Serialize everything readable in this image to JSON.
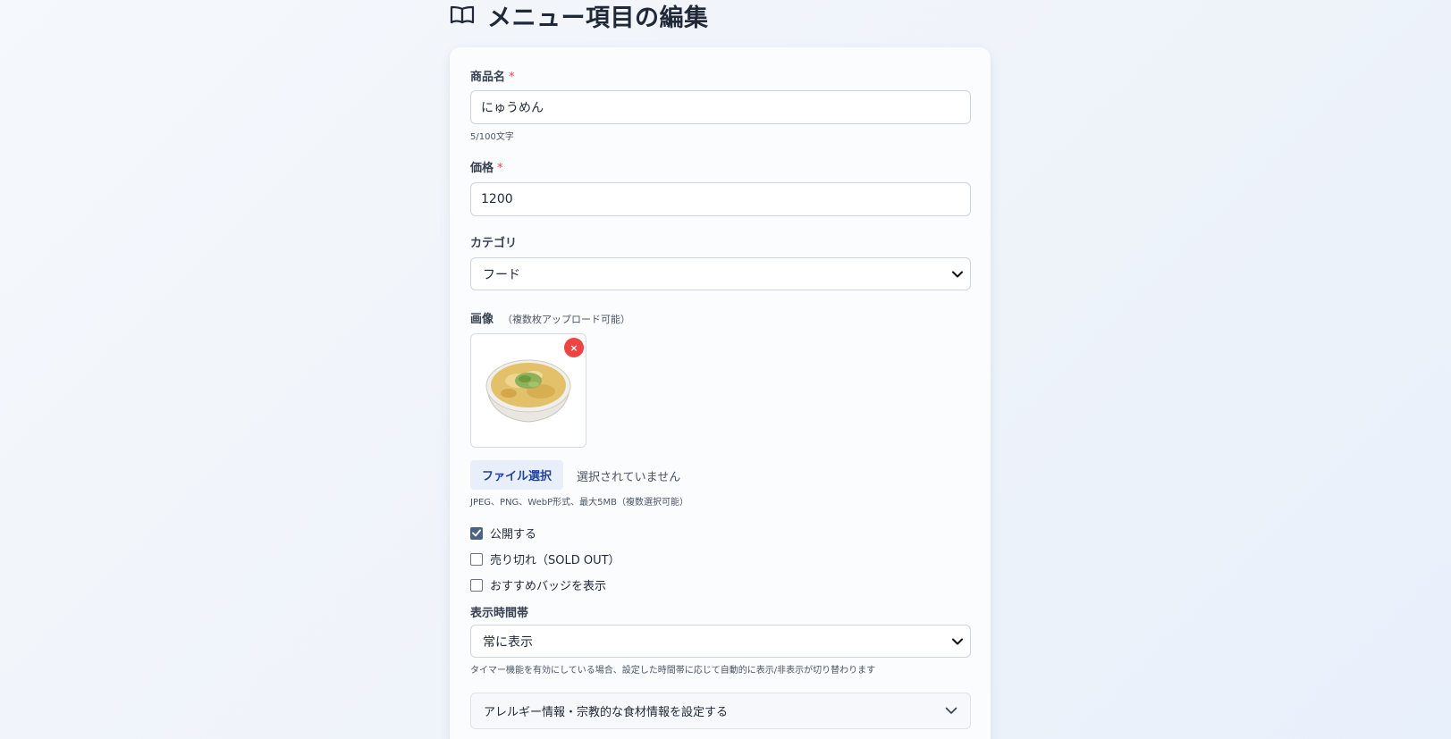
{
  "header": {
    "title": "メニュー項目の編集",
    "icon": "book-icon"
  },
  "form": {
    "name": {
      "label": "商品名",
      "required_mark": "*",
      "value": "にゅうめん",
      "counter": "5/100文字"
    },
    "price": {
      "label": "価格",
      "required_mark": "*",
      "value": "1200"
    },
    "category": {
      "label": "カテゴリ",
      "selected": "フード"
    },
    "images": {
      "label": "画像",
      "note": "（複数枚アップロード可能）",
      "remove_label": "×",
      "file_button": "ファイル選択",
      "file_status": "選択されていません",
      "helper": "JPEG、PNG、WebP形式、最大5MB（複数選択可能）"
    },
    "checkboxes": [
      {
        "label": "公開する",
        "checked": true
      },
      {
        "label": "売り切れ（SOLD OUT）",
        "checked": false
      },
      {
        "label": "おすすめバッジを表示",
        "checked": false
      }
    ],
    "display_time": {
      "label": "表示時間帯",
      "selected": "常に表示",
      "helper": "タイマー機能を有効にしている場合、設定した時間帯に応じて自動的に表示/非表示が切り替わります"
    },
    "allergy_section": {
      "label": "アレルギー情報・宗教的な食材情報を設定する"
    }
  },
  "colors": {
    "accent": "#1e3fa8",
    "danger": "#ef4444",
    "checkbox": "#4a6385"
  }
}
